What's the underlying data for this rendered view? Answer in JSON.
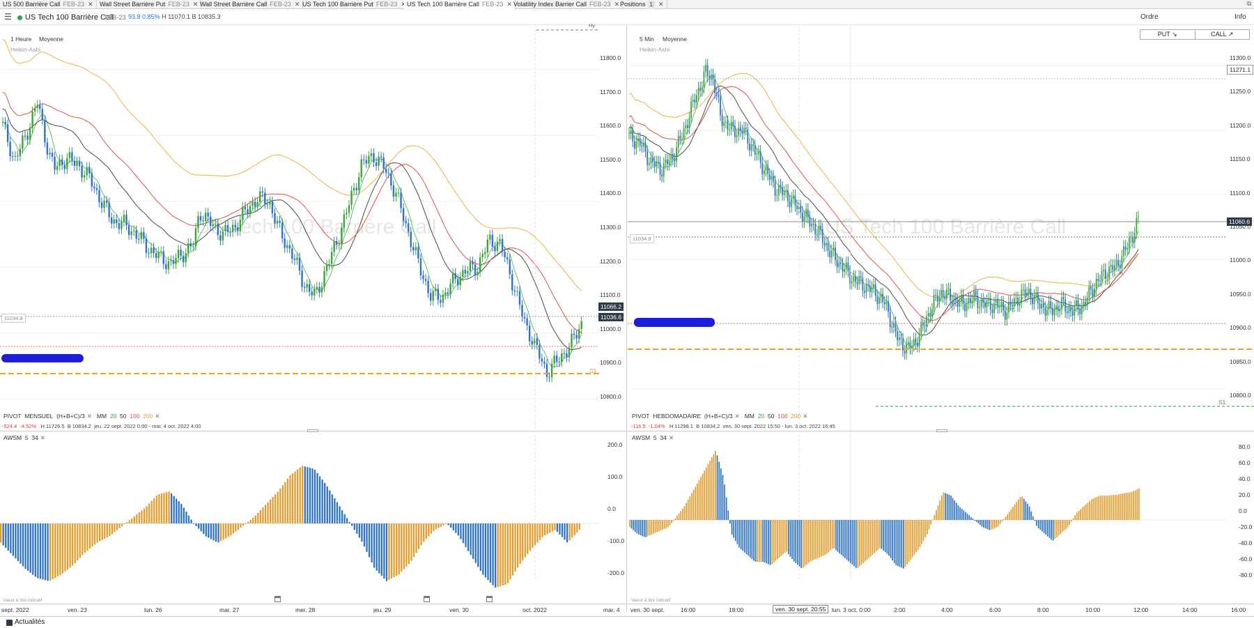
{
  "tabs": [
    {
      "label": "US 500 Barrière Call",
      "expiry": "FEB-23",
      "active": false
    },
    {
      "label": "Wall Street Barrière Put",
      "expiry": "FEB-23",
      "active": false
    },
    {
      "label": "Wall Street Barrière Call",
      "expiry": "FEB-23",
      "active": false
    },
    {
      "label": "US Tech 100 Barrière Put",
      "expiry": "FEB-23",
      "active": false
    },
    {
      "label": "US Tech 100 Barrière Call",
      "expiry": "FEB-23",
      "active": true
    },
    {
      "label": "Volatility Index Barrier Call",
      "expiry": "FEB-23",
      "active": false
    },
    {
      "label": "Positions",
      "count": "1",
      "active": false
    }
  ],
  "toolbar": {
    "instrument": "US Tech 100 Barrière Call",
    "expiry": "FEB-23",
    "price": "93.8",
    "change_pct": "0.85%",
    "high": "H 11070.1",
    "bid": "B 10835.3",
    "ordre_label": "Ordre",
    "info_label": "Info",
    "put_label": "PUT ↘",
    "call_label": "CALL ↗"
  },
  "left": {
    "interval": "1 Heure",
    "mode": "Moyenne",
    "chart_type": "Heikin-Ashi",
    "watermark": "US Tech 100 Barrière Call",
    "hy_label": "Hy",
    "pivot_row": {
      "pivot": "PIVOT",
      "period": "MENSUEL",
      "formula": "(H+B+C)/3",
      "mm": "MM",
      "p20": "20",
      "p50": "50",
      "p100": "100",
      "p200": "200"
    },
    "stats_row": {
      "change": "-524.4",
      "change_pct": "-4.52%",
      "high": "H 11726.5",
      "low": "B 10834.2",
      "range": "jeu. 22 sept. 2022 0:00 - mar. 4 oct. 2022 4:00"
    },
    "awsm_label": "AWSM",
    "awsm_fast": "5",
    "awsm_slow": "34",
    "value_label": "Valeur & titre Indicatif",
    "price_tag_1": "11066.2",
    "price_tag_2": "11036.6",
    "pale_tag": "11034.9",
    "s1_label": "S1",
    "yticks": [
      "11800.0",
      "11700.0",
      "11600.0",
      "11500.0",
      "11400.0",
      "11300.0",
      "11200.0",
      "11100.0",
      "11000.0",
      "10900.0",
      "10800.0"
    ],
    "osc_ticks": [
      "200.0",
      "100.0",
      "0.0",
      "-100.0",
      "-200.0"
    ],
    "xticks": [
      "sept. 2022",
      "ven. 23",
      "lun. 26",
      "mar. 27",
      "mer. 28",
      "jeu. 29",
      "ven. 30",
      "oct. 2022",
      "mar. 4"
    ]
  },
  "right": {
    "interval": "5 Min",
    "mode": "Moyenne",
    "chart_type": "Heikin-Ashi",
    "watermark": "US Tech 100 Barrière Call",
    "pivot_row": {
      "pivot": "PIVOT",
      "period": "HEBDOMADAIRE",
      "formula": "(H+B+C)/3",
      "mm": "MM",
      "p20": "20",
      "p50": "50",
      "p100": "100",
      "p200": "200"
    },
    "stats_row": {
      "change": "-116.5",
      "change_pct": "-1.04%",
      "high": "H 11298.1",
      "low": "B 10834.2",
      "range": "ven. 30 sept. 2022 15:50 - lun. 3 oct. 2022 16:45"
    },
    "awsm_label": "AWSM",
    "awsm_fast": "5",
    "awsm_slow": "34",
    "value_label": "Valeur & titre Indicatif",
    "price_tag_top": "11271.1",
    "price_tag_current": "11060.6",
    "pale_tag": "11034.9",
    "s1_label": "S1",
    "yticks": [
      "11300.0",
      "11250.0",
      "11200.0",
      "11150.0",
      "11100.0",
      "11050.0",
      "11000.0",
      "10950.0",
      "10900.0",
      "10850.0",
      "10800.0"
    ],
    "osc_ticks": [
      "80.0",
      "60.0",
      "40.0",
      "20.0",
      "0.0",
      "-20.0",
      "-40.0",
      "-60.0",
      "-80.0"
    ],
    "xticks": [
      "ven. 30 sept.",
      "16:00",
      "18:00",
      "2",
      "lun. 3 oct. 0:00",
      "2:00",
      "4:00",
      "6:00",
      "8:00",
      "10:00",
      "12:00",
      "14:00",
      "16:00"
    ],
    "crosshair_label": "ven. 30 sept. 20:55"
  },
  "footer": {
    "news_label": "Actualités"
  },
  "colors": {
    "up": "#3aa53a",
    "down": "#2f73c4",
    "ma20": "#64c064",
    "ma50": "#4a4a4a",
    "ma100": "#e0504a",
    "ma200": "#f0b040",
    "osc_up": "#e39d2e",
    "osc_down": "#2f73c4",
    "pivot": "#f0a020"
  },
  "chart_data": [
    {
      "type": "candlestick",
      "name": "left-price",
      "interval": "1 Heure",
      "ylim": [
        10750,
        11850
      ],
      "path_points": [
        [
          0,
          11630
        ],
        [
          2,
          11580
        ],
        [
          4,
          11520
        ],
        [
          6,
          11560
        ],
        [
          8,
          11600
        ],
        [
          10,
          11650
        ],
        [
          12,
          11700
        ],
        [
          14,
          11620
        ],
        [
          16,
          11540
        ],
        [
          18,
          11500
        ],
        [
          22,
          11530
        ],
        [
          26,
          11510
        ],
        [
          30,
          11470
        ],
        [
          34,
          11400
        ],
        [
          38,
          11340
        ],
        [
          42,
          11330
        ],
        [
          46,
          11300
        ],
        [
          50,
          11260
        ],
        [
          54,
          11230
        ],
        [
          58,
          11210
        ],
        [
          62,
          11240
        ],
        [
          66,
          11270
        ],
        [
          68,
          11370
        ],
        [
          72,
          11330
        ],
        [
          76,
          11300
        ],
        [
          80,
          11320
        ],
        [
          84,
          11370
        ],
        [
          88,
          11410
        ],
        [
          92,
          11400
        ],
        [
          96,
          11300
        ],
        [
          100,
          11240
        ],
        [
          104,
          11150
        ],
        [
          108,
          11110
        ],
        [
          112,
          11200
        ],
        [
          116,
          11290
        ],
        [
          120,
          11400
        ],
        [
          124,
          11510
        ],
        [
          128,
          11540
        ],
        [
          132,
          11500
        ],
        [
          136,
          11420
        ],
        [
          140,
          11310
        ],
        [
          144,
          11200
        ],
        [
          148,
          11110
        ],
        [
          152,
          11110
        ],
        [
          156,
          11160
        ],
        [
          160,
          11190
        ],
        [
          164,
          11200
        ],
        [
          168,
          11280
        ],
        [
          172,
          11270
        ],
        [
          176,
          11160
        ],
        [
          180,
          11040
        ],
        [
          184,
          10960
        ],
        [
          188,
          10880
        ],
        [
          192,
          10920
        ],
        [
          196,
          10960
        ],
        [
          200,
          11030
        ]
      ]
    },
    {
      "type": "candlestick",
      "name": "right-price",
      "interval": "5 Min",
      "ylim": [
        10780,
        11320
      ],
      "path_points": [
        [
          0,
          11190
        ],
        [
          6,
          11180
        ],
        [
          12,
          11150
        ],
        [
          18,
          11140
        ],
        [
          24,
          11160
        ],
        [
          30,
          11200
        ],
        [
          36,
          11250
        ],
        [
          42,
          11290
        ],
        [
          46,
          11280
        ],
        [
          50,
          11220
        ],
        [
          56,
          11200
        ],
        [
          62,
          11200
        ],
        [
          68,
          11170
        ],
        [
          74,
          11140
        ],
        [
          80,
          11110
        ],
        [
          86,
          11100
        ],
        [
          92,
          11080
        ],
        [
          98,
          11060
        ],
        [
          104,
          11040
        ],
        [
          110,
          11010
        ],
        [
          116,
          10990
        ],
        [
          122,
          10970
        ],
        [
          128,
          10960
        ],
        [
          134,
          10950
        ],
        [
          140,
          10930
        ],
        [
          146,
          10880
        ],
        [
          152,
          10860
        ],
        [
          158,
          10880
        ],
        [
          164,
          10920
        ],
        [
          170,
          10950
        ],
        [
          176,
          10940
        ],
        [
          182,
          10930
        ],
        [
          188,
          10940
        ],
        [
          194,
          10930
        ],
        [
          200,
          10930
        ],
        [
          206,
          10920
        ],
        [
          212,
          10940
        ],
        [
          218,
          10950
        ],
        [
          224,
          10930
        ],
        [
          230,
          10920
        ],
        [
          236,
          10930
        ],
        [
          242,
          10920
        ],
        [
          248,
          10930
        ],
        [
          254,
          10960
        ],
        [
          260,
          10980
        ],
        [
          266,
          10990
        ],
        [
          272,
          11020
        ],
        [
          278,
          11060
        ]
      ]
    },
    {
      "type": "bar",
      "name": "left-awsm",
      "ylim": [
        -250,
        250
      ],
      "values": [
        -60,
        -100,
        -140,
        -170,
        -180,
        -160,
        -130,
        -90,
        -60,
        -40,
        -10,
        20,
        50,
        90,
        100,
        60,
        0,
        -40,
        -60,
        -40,
        -10,
        20,
        60,
        100,
        150,
        180,
        170,
        120,
        60,
        0,
        -60,
        -140,
        -180,
        -160,
        -120,
        -60,
        -20,
        0,
        -40,
        -100,
        -160,
        -200,
        -190,
        -130,
        -80,
        -40,
        -20,
        -60,
        -20
      ]
    },
    {
      "type": "bar",
      "name": "right-awsm",
      "ylim": [
        -90,
        90
      ],
      "values": [
        -10,
        -20,
        -25,
        -20,
        -15,
        -10,
        5,
        20,
        40,
        60,
        80,
        100,
        60,
        -20,
        -40,
        -50,
        -60,
        -60,
        -65,
        -55,
        -45,
        -60,
        -70,
        -60,
        -55,
        -50,
        -40,
        -50,
        -60,
        -70,
        -60,
        -50,
        -40,
        -50,
        -65,
        -70,
        -55,
        -40,
        -20,
        10,
        40,
        35,
        20,
        10,
        0,
        -10,
        -15,
        -10,
        5,
        20,
        35,
        20,
        -10,
        -20,
        -30,
        -20,
        -10,
        10,
        20,
        30,
        35,
        35,
        36,
        38,
        40,
        45
      ]
    }
  ]
}
